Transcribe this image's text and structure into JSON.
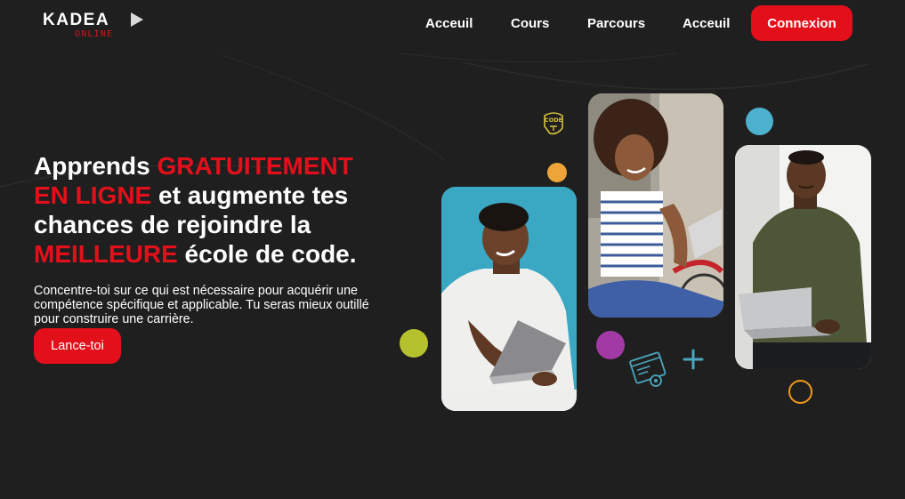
{
  "brand": {
    "name": "KADEA",
    "sub": "ONLINE"
  },
  "nav": {
    "items": [
      {
        "label": "Acceuil"
      },
      {
        "label": "Cours"
      },
      {
        "label": "Parcours"
      },
      {
        "label": "Acceuil"
      }
    ],
    "login_label": "Connexion"
  },
  "hero": {
    "title": {
      "part1": "Apprends ",
      "highlight1": "GRATUITEMENT EN LIGNE",
      "part2": " et augmente tes chances de rejoindre la ",
      "highlight2": "MEILLEURE",
      "part3": " école de code."
    },
    "description": "Concentre-toi sur ce qui est nécessaire pour acquérir une compétence spécifique et applicable. Tu seras mieux outillé pour construire une carrière.",
    "cta_label": "Lance-toi"
  },
  "decor": {
    "code_badge": "CODE"
  },
  "colors": {
    "background": "#1f1f1f",
    "accent": "#e3101b",
    "dot_green": "#b5c22e",
    "dot_purple": "#a23aa5",
    "dot_blue": "#4bb1cd",
    "dot_orange": "#eda53a",
    "ring_orange": "#f29a1a",
    "icon_teal": "#4aa7bd",
    "icon_yellow": "#d6c33a"
  }
}
